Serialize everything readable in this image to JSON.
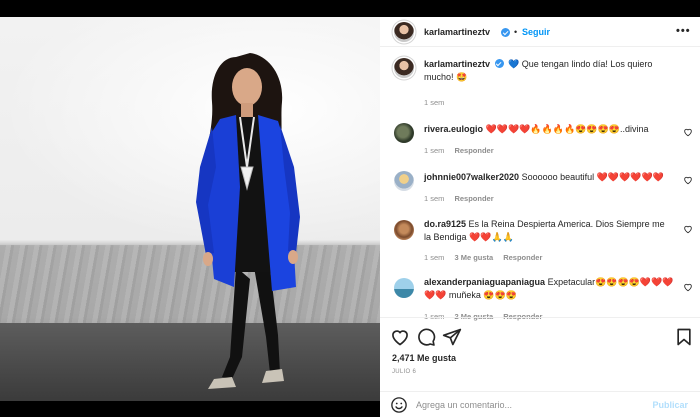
{
  "post": {
    "author": "karlamartineztv",
    "follow_label": "Seguir",
    "more_label": "•••",
    "separator": "•"
  },
  "caption": {
    "username": "karlamartineztv",
    "text": "💙 Que tengan lindo día! Los quiero mucho! 🤩",
    "time": "1 sem"
  },
  "comments": [
    {
      "username": "rivera.eulogio",
      "text": "❤️❤️❤️❤️🔥🔥🔥🔥😍😍😍😍..divina",
      "time": "1 sem",
      "likes": "",
      "reply": "Responder"
    },
    {
      "username": "johnnie007walker2020",
      "text": "Soooooo beautiful ❤️❤️❤️❤️❤️❤️",
      "time": "1 sem",
      "likes": "",
      "reply": "Responder"
    },
    {
      "username": "do.ra9125",
      "text": "Es la Reina Despierta America. Dios Siempre me la Bendiga ❤️❤️🙏🙏",
      "time": "1 sem",
      "likes": "3 Me gusta",
      "reply": "Responder"
    },
    {
      "username": "alexanderpaniaguapaniagua",
      "text": "Expetacular😍😍😍😍❤️❤️❤️❤️❤️ muñeka 😍😍😍",
      "time": "1 sem",
      "likes": "2 Me gusta",
      "reply": "Responder"
    }
  ],
  "actions": {
    "likes": "2,471 Me gusta",
    "date": "JULIO 6"
  },
  "composer": {
    "placeholder": "Agrega un comentario...",
    "publish_label": "Publicar"
  },
  "icons": [
    "smiley-icon",
    "heart-icon",
    "comment-icon",
    "share-icon",
    "bookmark-icon",
    "verified-badge-icon",
    "more-icon"
  ],
  "colors": {
    "accent": "#0095f6",
    "verified": "#3897f0",
    "jacket": "#1a3fd6",
    "publish_disabled": "#b2dffc"
  }
}
